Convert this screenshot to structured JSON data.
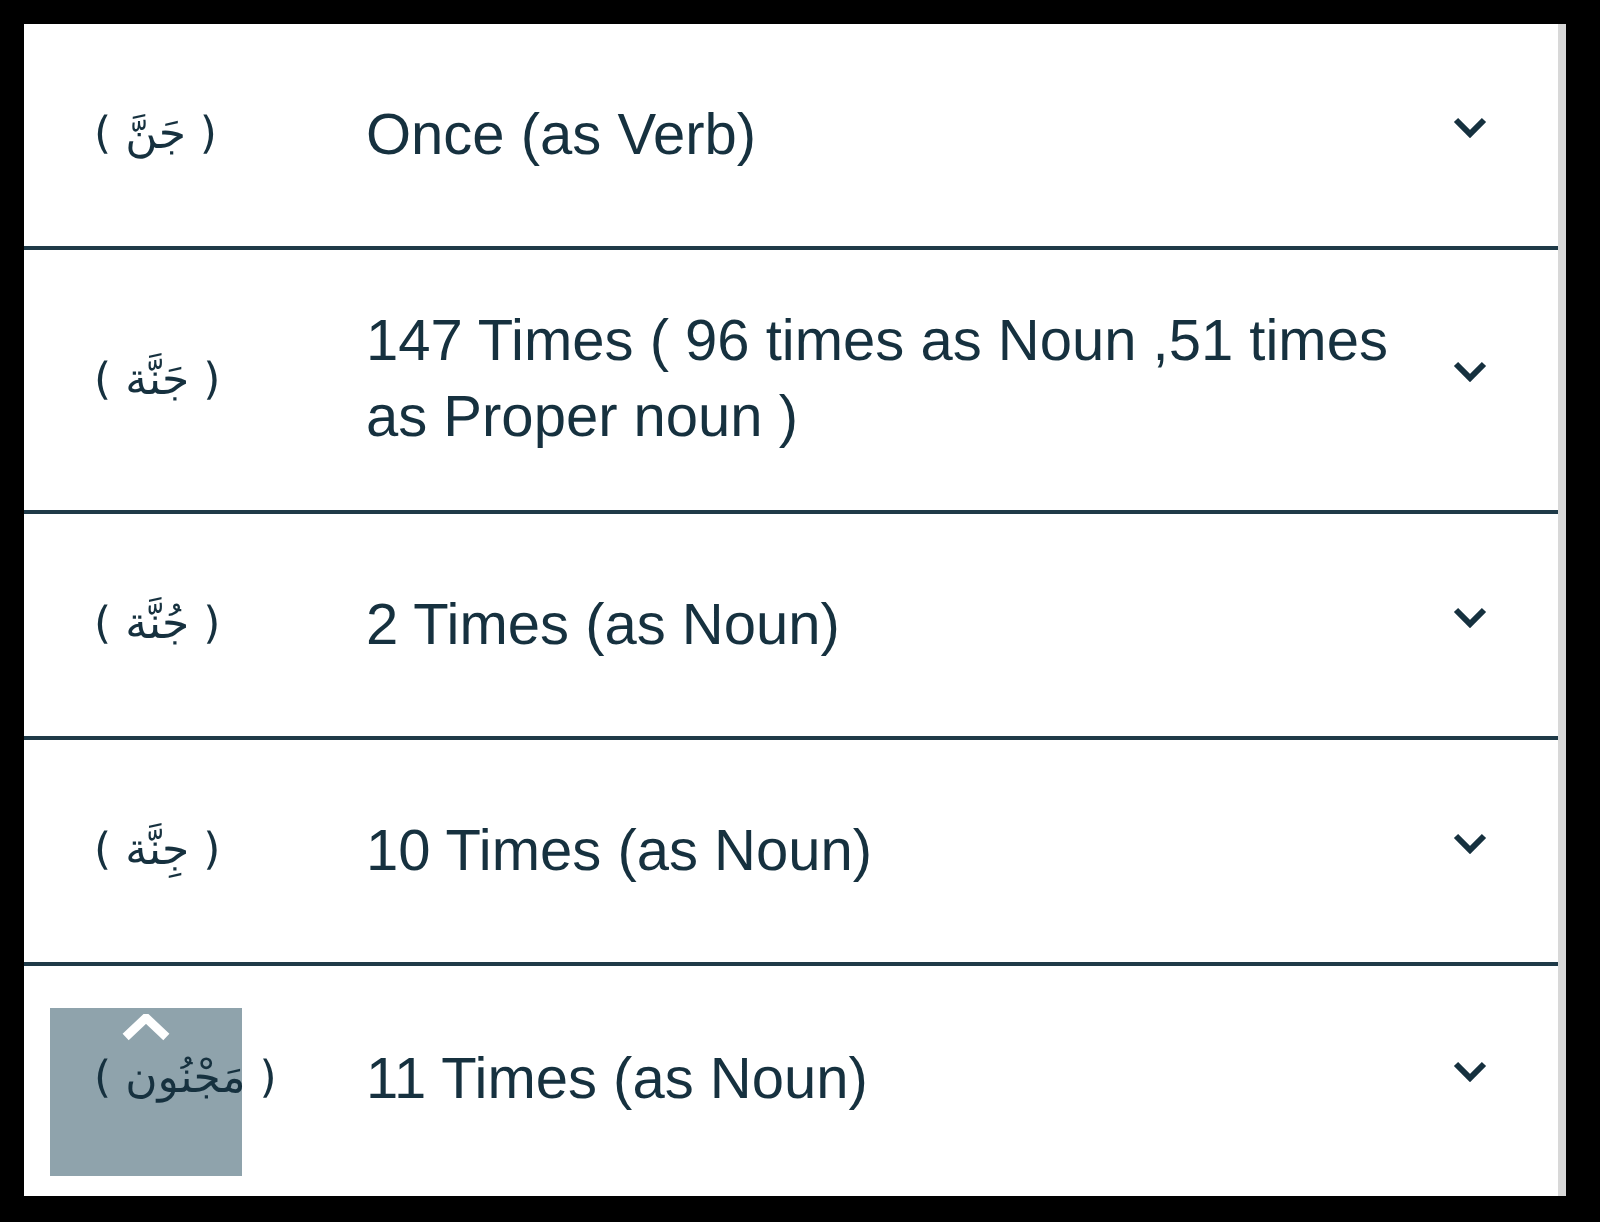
{
  "rows": [
    {
      "word": "( جَنَّ )",
      "occurrences": "Once (as Verb)",
      "expanded": false
    },
    {
      "word": "( جَنَّة )",
      "occurrences": "147 Times ( 96 times as Noun ,51 times as Proper noun )",
      "expanded": false
    },
    {
      "word": "( جُنَّة )",
      "occurrences": "2 Times (as Noun)",
      "expanded": false
    },
    {
      "word": "( جِنَّة )",
      "occurrences": "10 Times (as Noun)",
      "expanded": false
    },
    {
      "word": "( مَجْنُون )",
      "occurrences": "11 Times (as Noun)",
      "expanded": false
    }
  ]
}
